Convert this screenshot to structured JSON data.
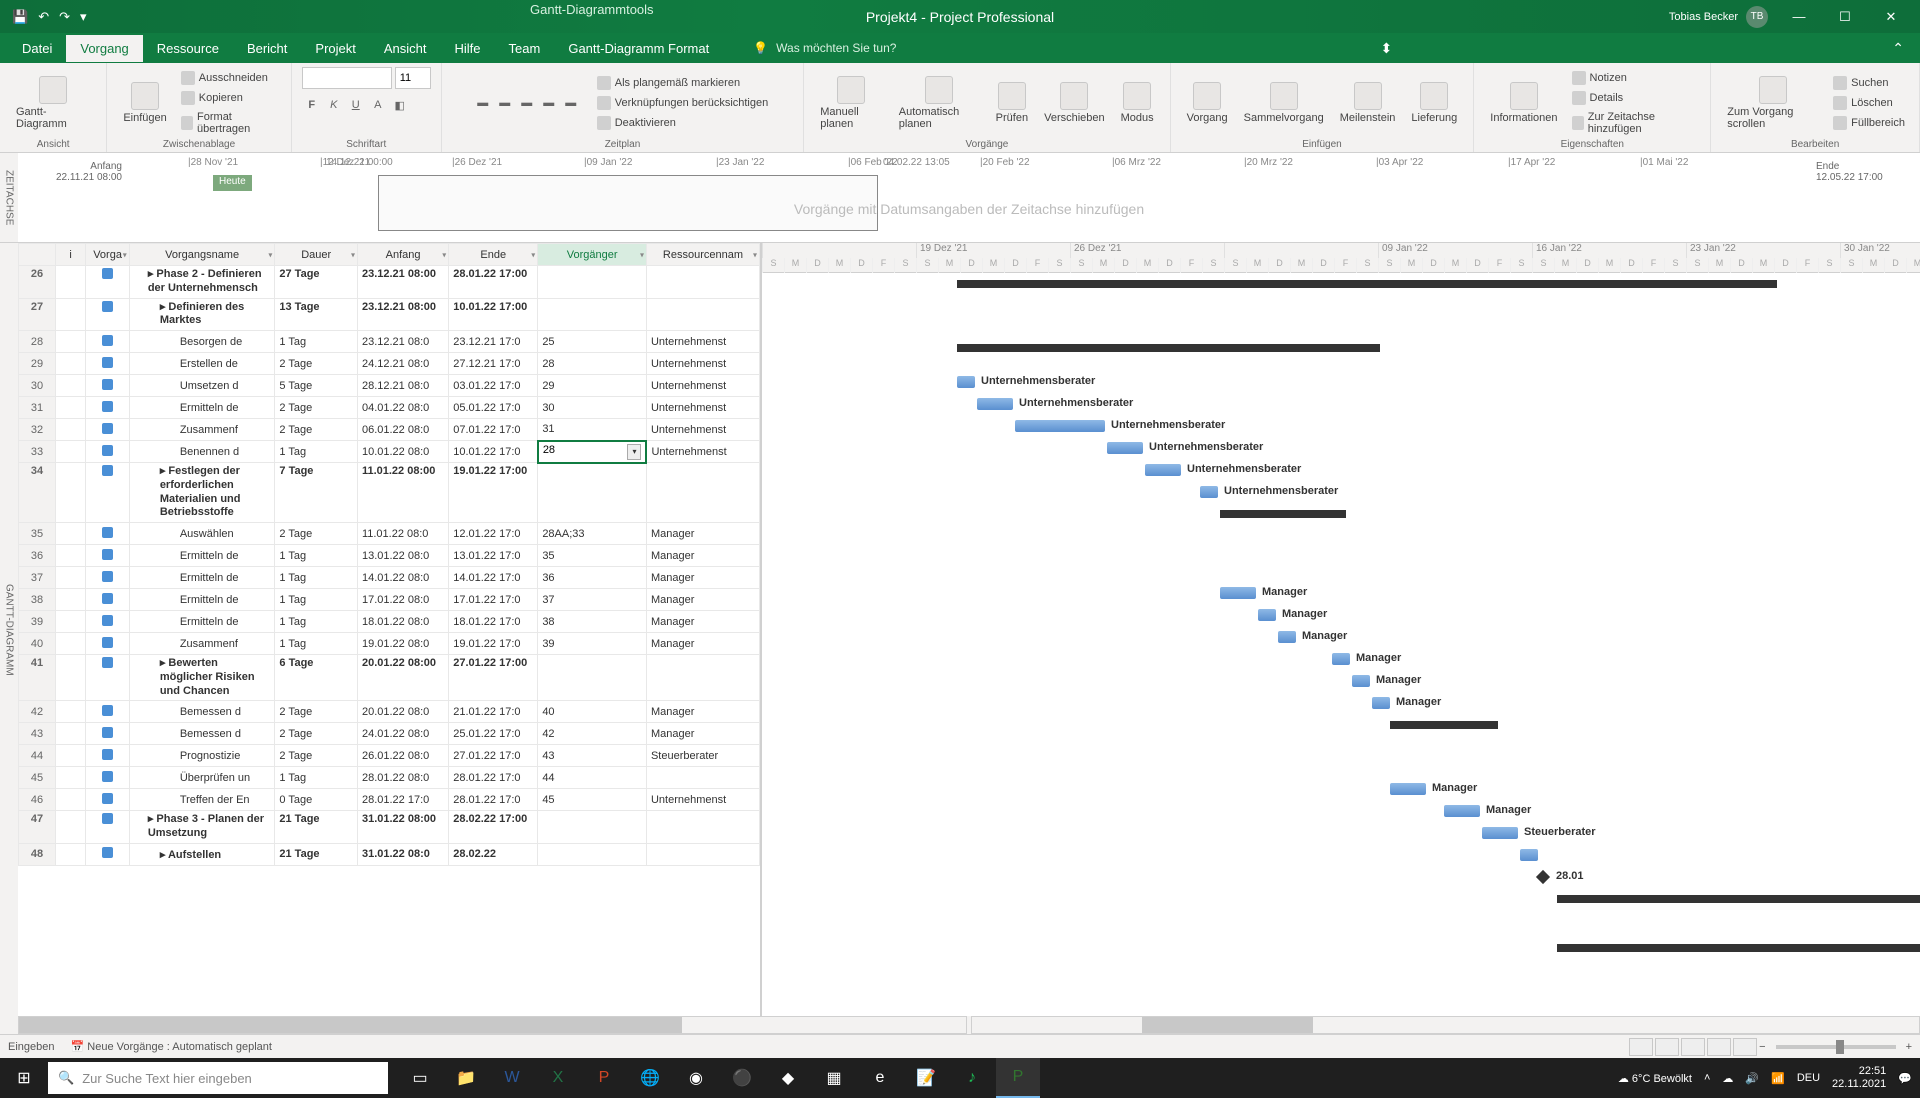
{
  "title": {
    "context_tool": "Gantt-Diagrammtools",
    "doc": "Projekt4  -  Project Professional",
    "user": "Tobias Becker",
    "initials": "TB"
  },
  "tabs": [
    "Datei",
    "Vorgang",
    "Ressource",
    "Bericht",
    "Projekt",
    "Ansicht",
    "Hilfe",
    "Team",
    "Gantt-Diagramm Format"
  ],
  "tellme": "Was möchten Sie tun?",
  "ribbon": {
    "views": "Ansicht",
    "views_btn": "Gantt-Diagramm",
    "clipboard": "Zwischenablage",
    "paste": "Einfügen",
    "cut": "Ausschneiden",
    "copy": "Kopieren",
    "format": "Format übertragen",
    "font": "Schriftart",
    "fontsize": "11",
    "schedule": "Zeitplan",
    "mark": "Als plangemäß markieren",
    "links": "Verknüpfungen berücksichtigen",
    "deact": "Deaktivieren",
    "tasks": "Vorgänge",
    "manual": "Manuell planen",
    "auto": "Automatisch planen",
    "inspect": "Prüfen",
    "move": "Verschieben",
    "mode": "Modus",
    "insert": "Einfügen",
    "task": "Vorgang",
    "summary": "Sammelvorgang",
    "milestone": "Meilenstein",
    "deliv": "Lieferung",
    "props": "Eigenschaften",
    "info": "Informationen",
    "notes": "Notizen",
    "details": "Details",
    "timeline": "Zur Zeitachse hinzufügen",
    "edit": "Bearbeiten",
    "goto": "Zum Vorgang scrollen",
    "find": "Suchen",
    "clear": "Löschen",
    "fill": "Füllbereich"
  },
  "timeline": {
    "side": "ZEITACHSE",
    "start_lbl": "Anfang",
    "start": "22.11.21 08:00",
    "end_lbl": "Ende",
    "end": "12.05.22 17:00",
    "heute": "Heute",
    "bar_start": "14.12.21 00:00",
    "bar_end": "04.02.22 13:05",
    "ticks": [
      "28 Nov '21",
      "12 Dez '21",
      "26 Dez '21",
      "09 Jan '22",
      "23 Jan '22",
      "06 Feb '22",
      "20 Feb '22",
      "06 Mrz '22",
      "20 Mrz '22",
      "03 Apr '22",
      "17 Apr '22",
      "01 Mai '22"
    ],
    "hint": "Vorgänge mit Datumsangaben der Zeitachse hinzufügen"
  },
  "cols": {
    "info": "i",
    "mode": "Vorga",
    "name": "Vorgangsname",
    "dur": "Dauer",
    "start": "Anfang",
    "end": "Ende",
    "pred": "Vorgänger",
    "res": "Ressourcennam"
  },
  "gantt_side": "GANTT-DIAGRAMM",
  "gantt_weeks": [
    "",
    "19 Dez '21",
    "26 Dez '21",
    "",
    "09 Jan '22",
    "16 Jan '22",
    "23 Jan '22",
    "30 Jan '22"
  ],
  "gantt_days": [
    "S",
    "M",
    "D",
    "M",
    "D",
    "F",
    "S"
  ],
  "rows": [
    {
      "n": 26,
      "sum": true,
      "name": "Phase 2 - Definieren der Unternehmensch",
      "dur": "27 Tage",
      "start": "23.12.21 08:00",
      "end": "28.01.22 17:00",
      "pred": "",
      "res": "",
      "bar": [
        195,
        820
      ],
      "lbl": ""
    },
    {
      "n": 27,
      "sum": true,
      "name": "Definieren des Marktes",
      "dur": "13 Tage",
      "start": "23.12.21 08:00",
      "end": "10.01.22 17:00",
      "pred": "",
      "res": "",
      "bar": [
        195,
        423
      ],
      "lbl": ""
    },
    {
      "n": 28,
      "name": "Besorgen de",
      "dur": "1 Tag",
      "start": "23.12.21 08:0",
      "end": "23.12.21 17:0",
      "pred": "25",
      "res": "Unternehmenst",
      "bar": [
        195,
        18
      ],
      "lbl": "Unternehmensberater"
    },
    {
      "n": 29,
      "name": "Erstellen de",
      "dur": "2 Tage",
      "start": "24.12.21 08:0",
      "end": "27.12.21 17:0",
      "pred": "28",
      "res": "Unternehmenst",
      "bar": [
        215,
        36
      ],
      "lbl": "Unternehmensberater"
    },
    {
      "n": 30,
      "name": "Umsetzen d",
      "dur": "5 Tage",
      "start": "28.12.21 08:0",
      "end": "03.01.22 17:0",
      "pred": "29",
      "res": "Unternehmenst",
      "bar": [
        253,
        90
      ],
      "lbl": "Unternehmensberater"
    },
    {
      "n": 31,
      "name": "Ermitteln de",
      "dur": "2 Tage",
      "start": "04.01.22 08:0",
      "end": "05.01.22 17:0",
      "pred": "30",
      "res": "Unternehmenst",
      "bar": [
        345,
        36
      ],
      "lbl": "Unternehmensberater"
    },
    {
      "n": 32,
      "name": "Zusammenf",
      "dur": "2 Tage",
      "start": "06.01.22 08:0",
      "end": "07.01.22 17:0",
      "pred": "31",
      "res": "Unternehmenst",
      "bar": [
        383,
        36
      ],
      "lbl": "Unternehmensberater"
    },
    {
      "n": 33,
      "name": "Benennen d",
      "dur": "1 Tag",
      "start": "10.01.22 08:0",
      "end": "10.01.22 17:0",
      "pred": "28",
      "res": "Unternehmenst",
      "bar": [
        438,
        18
      ],
      "lbl": "Unternehmensberater",
      "edit": true
    },
    {
      "n": 34,
      "sum": true,
      "name": "Festlegen der erforderlichen Materialien und Betriebsstoffe",
      "dur": "7 Tage",
      "start": "11.01.22 08:00",
      "end": "19.01.22 17:00",
      "pred": "",
      "res": "",
      "bar": [
        458,
        126
      ],
      "lbl": ""
    },
    {
      "n": 35,
      "name": "Auswählen",
      "dur": "2 Tage",
      "start": "11.01.22 08:0",
      "end": "12.01.22 17:0",
      "pred": "28AA;33",
      "res": "Manager",
      "bar": [
        458,
        36
      ],
      "lbl": "Manager"
    },
    {
      "n": 36,
      "name": "Ermitteln de",
      "dur": "1 Tag",
      "start": "13.01.22 08:0",
      "end": "13.01.22 17:0",
      "pred": "35",
      "res": "Manager",
      "bar": [
        496,
        18
      ],
      "lbl": "Manager"
    },
    {
      "n": 37,
      "name": "Ermitteln de",
      "dur": "1 Tag",
      "start": "14.01.22 08:0",
      "end": "14.01.22 17:0",
      "pred": "36",
      "res": "Manager",
      "bar": [
        516,
        18
      ],
      "lbl": "Manager"
    },
    {
      "n": 38,
      "name": "Ermitteln de",
      "dur": "1 Tag",
      "start": "17.01.22 08:0",
      "end": "17.01.22 17:0",
      "pred": "37",
      "res": "Manager",
      "bar": [
        570,
        18
      ],
      "lbl": "Manager"
    },
    {
      "n": 39,
      "name": "Ermitteln de",
      "dur": "1 Tag",
      "start": "18.01.22 08:0",
      "end": "18.01.22 17:0",
      "pred": "38",
      "res": "Manager",
      "bar": [
        590,
        18
      ],
      "lbl": "Manager"
    },
    {
      "n": 40,
      "name": "Zusammenf",
      "dur": "1 Tag",
      "start": "19.01.22 08:0",
      "end": "19.01.22 17:0",
      "pred": "39",
      "res": "Manager",
      "bar": [
        610,
        18
      ],
      "lbl": "Manager"
    },
    {
      "n": 41,
      "sum": true,
      "name": "Bewerten möglicher Risiken und Chancen",
      "dur": "6 Tage",
      "start": "20.01.22 08:00",
      "end": "27.01.22 17:00",
      "pred": "",
      "res": "",
      "bar": [
        628,
        108
      ],
      "lbl": ""
    },
    {
      "n": 42,
      "name": "Bemessen d",
      "dur": "2 Tage",
      "start": "20.01.22 08:0",
      "end": "21.01.22 17:0",
      "pred": "40",
      "res": "Manager",
      "bar": [
        628,
        36
      ],
      "lbl": "Manager"
    },
    {
      "n": 43,
      "name": "Bemessen d",
      "dur": "2 Tage",
      "start": "24.01.22 08:0",
      "end": "25.01.22 17:0",
      "pred": "42",
      "res": "Manager",
      "bar": [
        682,
        36
      ],
      "lbl": "Manager"
    },
    {
      "n": 44,
      "name": "Prognostizie",
      "dur": "2 Tage",
      "start": "26.01.22 08:0",
      "end": "27.01.22 17:0",
      "pred": "43",
      "res": "Steuerberater",
      "bar": [
        720,
        36
      ],
      "lbl": "Steuerberater"
    },
    {
      "n": 45,
      "name": "Überprüfen un",
      "dur": "1 Tag",
      "start": "28.01.22 08:0",
      "end": "28.01.22 17:0",
      "pred": "44",
      "res": "",
      "bar": [
        758,
        18
      ],
      "lbl": ""
    },
    {
      "n": 46,
      "name": "Treffen der En",
      "dur": "0 Tage",
      "start": "28.01.22 17:0",
      "end": "28.01.22 17:0",
      "pred": "45",
      "res": "Unternehmenst",
      "ms": 776,
      "lbl": "28.01"
    },
    {
      "n": 47,
      "sum": true,
      "name": "Phase 3 - Planen der Umsetzung",
      "dur": "21 Tage",
      "start": "31.01.22 08:00",
      "end": "28.02.22 17:00",
      "pred": "",
      "res": "",
      "bar": [
        795,
        380
      ],
      "lbl": ""
    },
    {
      "n": 48,
      "sum": true,
      "name": "Aufstellen",
      "dur": "21 Tage",
      "start": "31.01.22 08:0",
      "end": "28.02.22",
      "pred": "",
      "res": "",
      "bar": [
        795,
        380
      ],
      "lbl": ""
    }
  ],
  "status": {
    "mode": "Eingeben",
    "auto": "Neue Vorgänge : Automatisch geplant"
  },
  "taskbar": {
    "search": "Zur Suche Text hier eingeben",
    "weather": "6°C  Bewölkt",
    "lang": "DEU",
    "time": "22:51",
    "date": "22.11.2021"
  }
}
